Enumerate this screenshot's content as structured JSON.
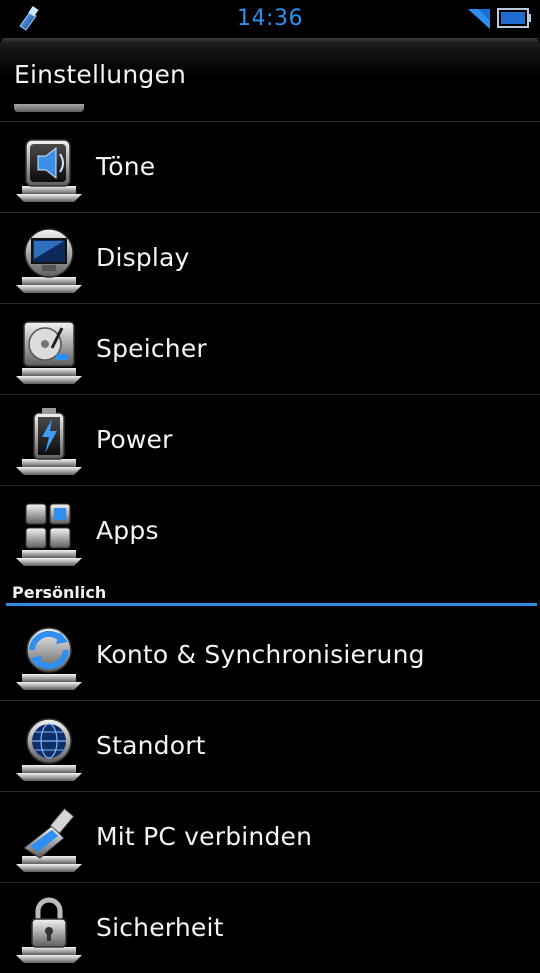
{
  "status_bar": {
    "time": "14:36",
    "icons": [
      "usb-debug-icon",
      "signal-icon",
      "battery-icon"
    ],
    "time_color": "#2f8ff0"
  },
  "title": "Einstellungen",
  "device_items": [
    {
      "label": "Töne",
      "icon": "speaker-icon"
    },
    {
      "label": "Display",
      "icon": "monitor-icon"
    },
    {
      "label": "Speicher",
      "icon": "hard-drive-icon"
    },
    {
      "label": "Power",
      "icon": "battery-power-icon"
    },
    {
      "label": "Apps",
      "icon": "apps-grid-icon"
    }
  ],
  "section": {
    "title": "Persönlich",
    "rule_color": "#2e8ee6"
  },
  "personal_items": [
    {
      "label": "Konto & Synchronisierung",
      "icon": "sync-icon"
    },
    {
      "label": "Standort",
      "icon": "globe-icon"
    },
    {
      "label": "Mit PC verbinden",
      "icon": "usb-connect-icon"
    },
    {
      "label": "Sicherheit",
      "icon": "lock-icon"
    }
  ]
}
